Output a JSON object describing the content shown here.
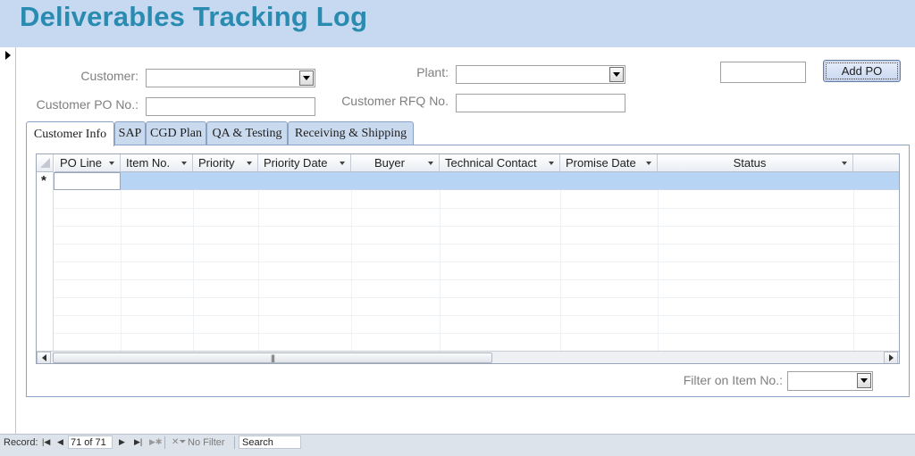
{
  "form": {
    "title": "Deliverables Tracking Log"
  },
  "fields": {
    "customer_label": "Customer:",
    "plant_label": "Plant:",
    "customer_po_label": "Customer PO No.:",
    "customer_rfq_label": "Customer RFQ No.",
    "filter_item_label": "Filter on Item No.:"
  },
  "buttons": {
    "add_po": "Add PO"
  },
  "tabs": [
    {
      "label": "Customer Info",
      "active": true
    },
    {
      "label": "SAP"
    },
    {
      "label": "CGD Plan"
    },
    {
      "label": "QA & Testing"
    },
    {
      "label": "Receiving & Shipping"
    }
  ],
  "datasheet": {
    "columns": [
      "PO Line",
      "Item No.",
      "Priority",
      "Priority Date",
      "Buyer",
      "Technical Contact",
      "Promise Date",
      "Status"
    ],
    "new_row_marker": "*"
  },
  "status_bar": {
    "record_label": "Record:",
    "record_position": "71 of 71",
    "filter_label": "No Filter",
    "search_label": "Search"
  },
  "icons": [
    "selector-arrow-icon",
    "dropdown-arrow-icon",
    "first-record-icon",
    "previous-record-icon",
    "next-record-icon",
    "last-record-icon",
    "new-record-icon",
    "no-filter-icon"
  ]
}
